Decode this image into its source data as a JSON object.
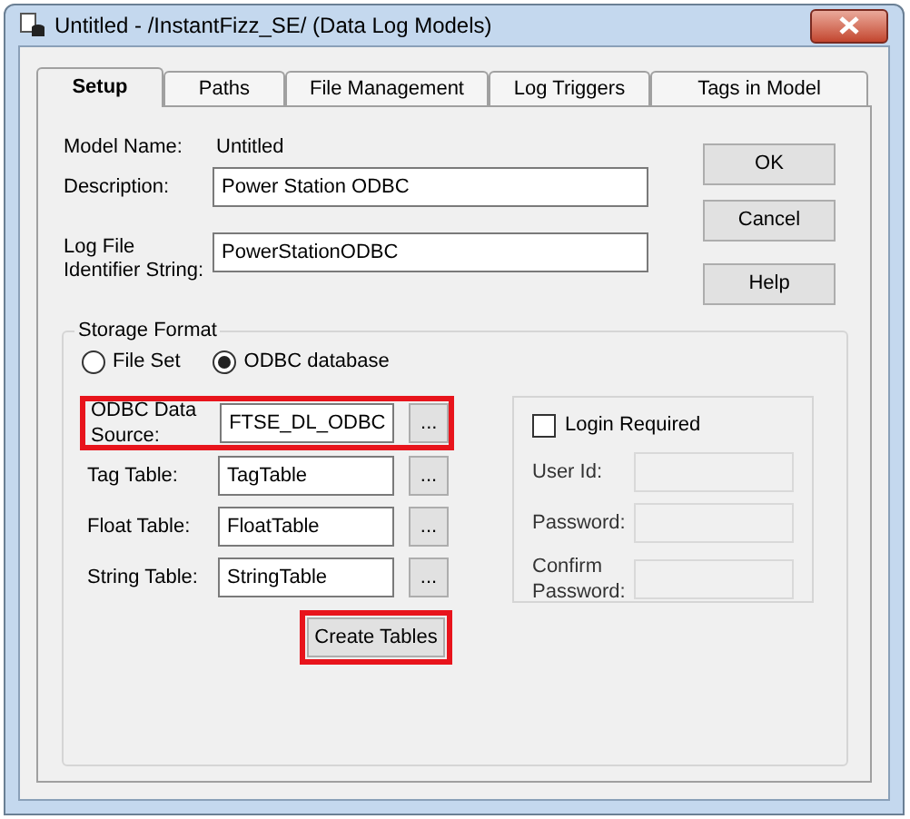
{
  "window": {
    "title": "Untitled - /InstantFizz_SE/ (Data Log Models)"
  },
  "tabs": [
    {
      "label": "Setup",
      "selected": true
    },
    {
      "label": "Paths",
      "selected": false
    },
    {
      "label": "File Management",
      "selected": false
    },
    {
      "label": "Log Triggers",
      "selected": false
    },
    {
      "label": "Tags in Model",
      "selected": false
    }
  ],
  "model_name": {
    "label": "Model Name:",
    "value": "Untitled"
  },
  "description": {
    "label": "Description:",
    "value": "Power Station ODBC"
  },
  "log_file_identifier": {
    "label": "Log File Identifier String:",
    "value": "PowerStationODBC"
  },
  "buttons": [
    "OK",
    "Cancel",
    "Help"
  ],
  "storage_format": {
    "title": "Storage Format",
    "options": [
      {
        "label": "File Set",
        "selected": false
      },
      {
        "label": "ODBC database",
        "selected": true
      }
    ],
    "tables": [
      {
        "label": "ODBC Data Source:",
        "value": "FTSE_DL_ODBC",
        "browse": "...",
        "highlighted": true
      },
      {
        "label": "Tag Table:",
        "value": "TagTable",
        "browse": "...",
        "highlighted": false
      },
      {
        "label": "Float Table:",
        "value": "FloatTable",
        "browse": "...",
        "highlighted": false
      },
      {
        "label": "String Table:",
        "value": "StringTable",
        "browse": "...",
        "highlighted": false
      }
    ],
    "create_tables": {
      "label": "Create Tables",
      "highlighted": true
    },
    "login": {
      "label": "Login Required",
      "checked": false,
      "fields": [
        {
          "label": "User Id:"
        },
        {
          "label": "Password:"
        },
        {
          "label": "Confirm Password:"
        }
      ]
    }
  }
}
